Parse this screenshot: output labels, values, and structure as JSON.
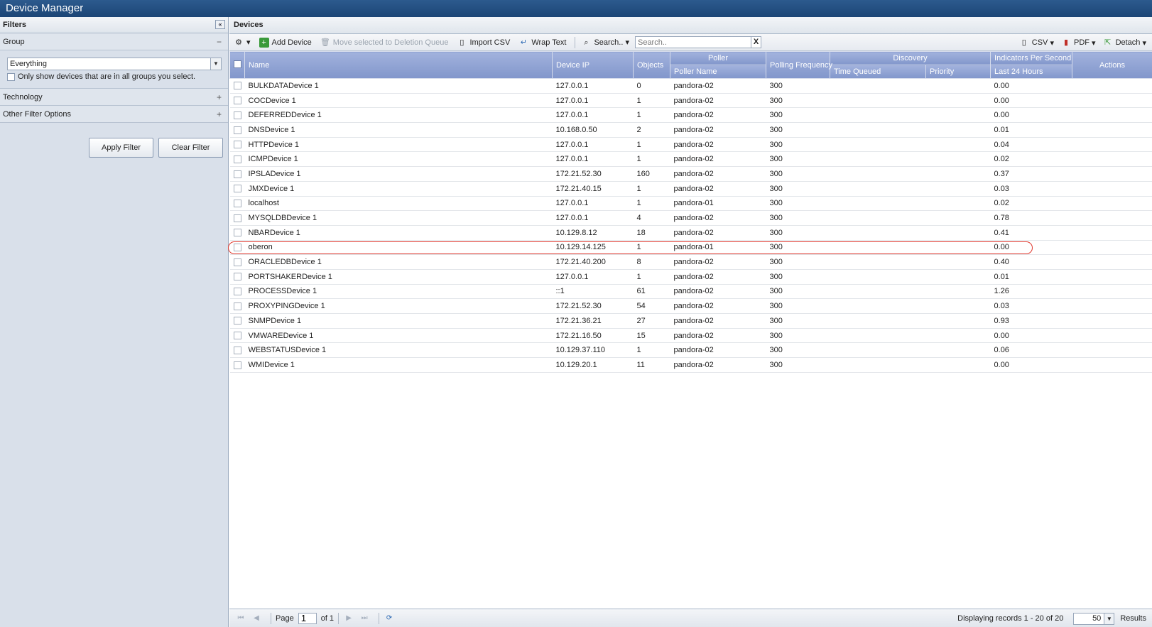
{
  "app": {
    "title": "Device Manager"
  },
  "filters": {
    "header": "Filters",
    "collapse_glyph": "«",
    "group": {
      "label": "Group",
      "toggle": "−",
      "selected": "Everything",
      "checkbox_label": "Only show devices that are in all groups you select."
    },
    "technology": {
      "label": "Technology",
      "toggle": "+"
    },
    "other": {
      "label": "Other Filter Options",
      "toggle": "+"
    },
    "apply_label": "Apply Filter",
    "clear_label": "Clear Filter"
  },
  "devices": {
    "header": "Devices",
    "toolbar": {
      "add_device": "Add Device",
      "move_deletion": "Move selected to Deletion Queue",
      "import_csv": "Import CSV",
      "wrap_text": "Wrap Text",
      "search_menu": "Search..",
      "search_placeholder": "Search..",
      "search_clear": "X",
      "csv": "CSV",
      "pdf": "PDF",
      "detach": "Detach"
    },
    "columns": {
      "name": "Name",
      "device_ip": "Device IP",
      "objects": "Objects",
      "poller": "Poller",
      "poller_name": "Poller Name",
      "polling_frequency": "Polling Frequency",
      "discovery": "Discovery",
      "time_queued": "Time Queued",
      "priority": "Priority",
      "indicators": "Indicators Per Second",
      "last_24": "Last 24 Hours",
      "actions": "Actions"
    },
    "rows": [
      {
        "name": "BULKDATADevice 1",
        "ip": "127.0.0.1",
        "objects": "0",
        "poller": "pandora-02",
        "freq": "300",
        "ips": "0.00"
      },
      {
        "name": "COCDevice 1",
        "ip": "127.0.0.1",
        "objects": "1",
        "poller": "pandora-02",
        "freq": "300",
        "ips": "0.00"
      },
      {
        "name": "DEFERREDDevice 1",
        "ip": "127.0.0.1",
        "objects": "1",
        "poller": "pandora-02",
        "freq": "300",
        "ips": "0.00"
      },
      {
        "name": "DNSDevice 1",
        "ip": "10.168.0.50",
        "objects": "2",
        "poller": "pandora-02",
        "freq": "300",
        "ips": "0.01"
      },
      {
        "name": "HTTPDevice 1",
        "ip": "127.0.0.1",
        "objects": "1",
        "poller": "pandora-02",
        "freq": "300",
        "ips": "0.04"
      },
      {
        "name": "ICMPDevice 1",
        "ip": "127.0.0.1",
        "objects": "1",
        "poller": "pandora-02",
        "freq": "300",
        "ips": "0.02"
      },
      {
        "name": "IPSLADevice 1",
        "ip": "172.21.52.30",
        "objects": "160",
        "poller": "pandora-02",
        "freq": "300",
        "ips": "0.37"
      },
      {
        "name": "JMXDevice 1",
        "ip": "172.21.40.15",
        "objects": "1",
        "poller": "pandora-02",
        "freq": "300",
        "ips": "0.03"
      },
      {
        "name": "localhost",
        "ip": "127.0.0.1",
        "objects": "1",
        "poller": "pandora-01",
        "freq": "300",
        "ips": "0.02"
      },
      {
        "name": "MYSQLDBDevice 1",
        "ip": "127.0.0.1",
        "objects": "4",
        "poller": "pandora-02",
        "freq": "300",
        "ips": "0.78"
      },
      {
        "name": "NBARDevice 1",
        "ip": "10.129.8.12",
        "objects": "18",
        "poller": "pandora-02",
        "freq": "300",
        "ips": "0.41"
      },
      {
        "name": "oberon",
        "ip": "10.129.14.125",
        "objects": "1",
        "poller": "pandora-01",
        "freq": "300",
        "ips": "0.00"
      },
      {
        "name": "ORACLEDBDevice 1",
        "ip": "172.21.40.200",
        "objects": "8",
        "poller": "pandora-02",
        "freq": "300",
        "ips": "0.40"
      },
      {
        "name": "PORTSHAKERDevice 1",
        "ip": "127.0.0.1",
        "objects": "1",
        "poller": "pandora-02",
        "freq": "300",
        "ips": "0.01"
      },
      {
        "name": "PROCESSDevice 1",
        "ip": "::1",
        "objects": "61",
        "poller": "pandora-02",
        "freq": "300",
        "ips": "1.26"
      },
      {
        "name": "PROXYPINGDevice 1",
        "ip": "172.21.52.30",
        "objects": "54",
        "poller": "pandora-02",
        "freq": "300",
        "ips": "0.03"
      },
      {
        "name": "SNMPDevice 1",
        "ip": "172.21.36.21",
        "objects": "27",
        "poller": "pandora-02",
        "freq": "300",
        "ips": "0.93"
      },
      {
        "name": "VMWAREDevice 1",
        "ip": "172.21.16.50",
        "objects": "15",
        "poller": "pandora-02",
        "freq": "300",
        "ips": "0.00"
      },
      {
        "name": "WEBSTATUSDevice 1",
        "ip": "10.129.37.110",
        "objects": "1",
        "poller": "pandora-02",
        "freq": "300",
        "ips": "0.06"
      },
      {
        "name": "WMIDevice 1",
        "ip": "10.129.20.1",
        "objects": "11",
        "poller": "pandora-02",
        "freq": "300",
        "ips": "0.00"
      }
    ],
    "paging": {
      "page_label": "Page",
      "page_value": "1",
      "of_label": "of 1",
      "display_text": "Displaying records 1 - 20 of 20",
      "page_size": "50",
      "results_label": "Results"
    }
  },
  "colors": {
    "title_bar": "#1c4576",
    "header_blue": "#8196cb",
    "highlight": "#e03a2f"
  }
}
